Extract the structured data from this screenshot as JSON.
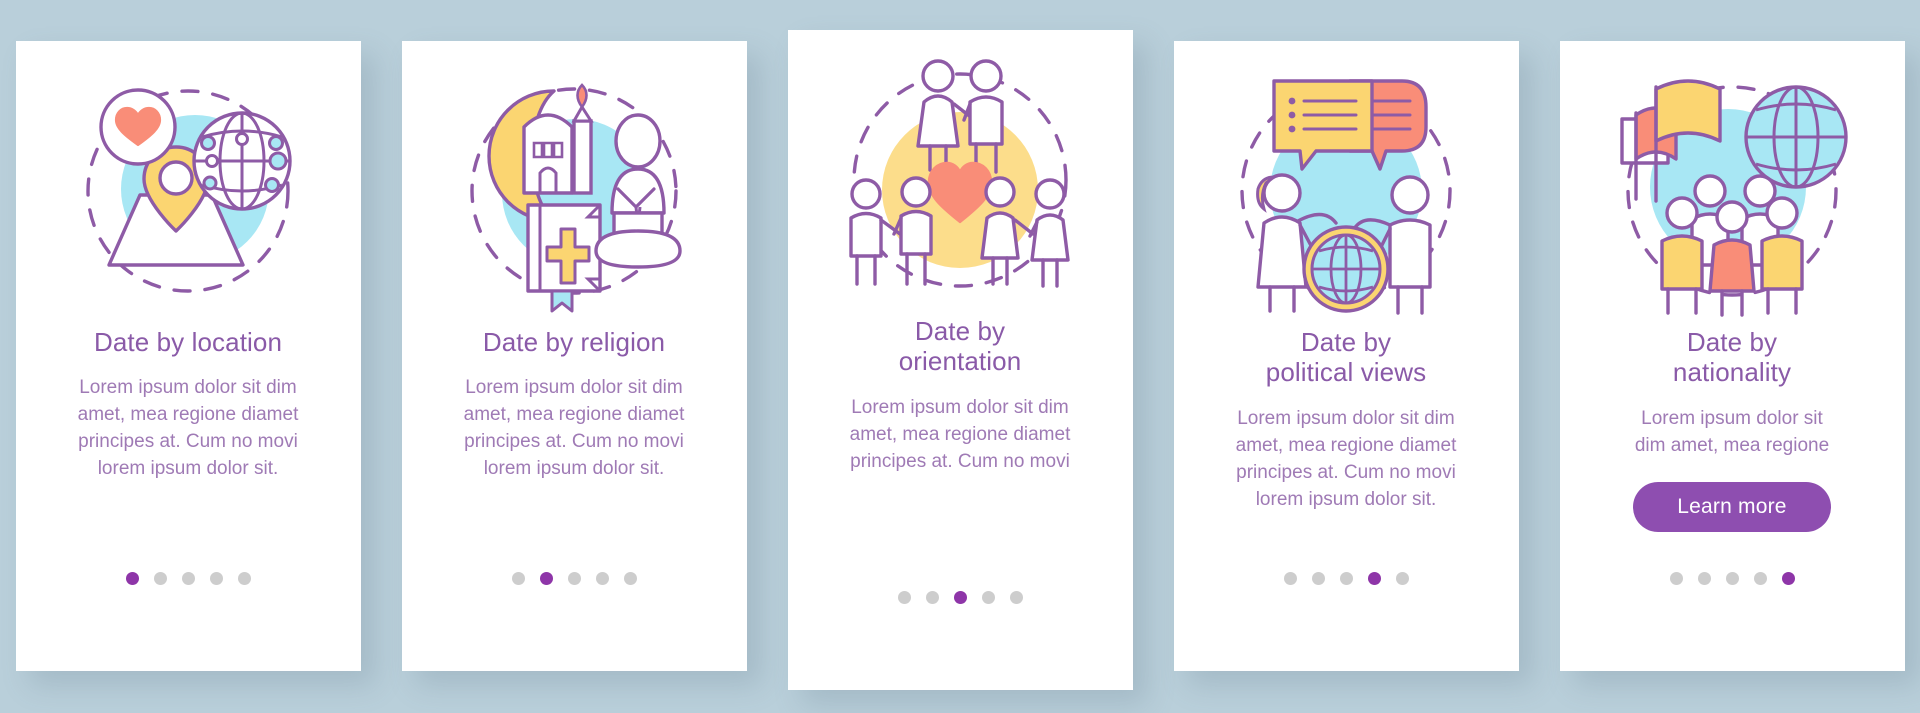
{
  "theme": {
    "background": "#b9cfda",
    "card_background": "#ffffff",
    "title_color": "#8a5aa8",
    "body_color": "#9f7ab5",
    "accent_purple": "#8e4eb0",
    "dot_active": "#8e35a8",
    "dot_inactive": "#cdcdcd",
    "illo_stroke": "#8e5ba6",
    "illo_blue": "#a8e7f4",
    "illo_yellow": "#fbd571",
    "illo_coral": "#f98d78"
  },
  "screens": [
    {
      "id": "date-by-location",
      "icon": "location-heart-globe-icon",
      "title_lines": [
        "Date by location"
      ],
      "body_lines": [
        "Lorem ipsum dolor sit dim",
        "amet, mea regione diamet",
        "principes at. Cum no movi",
        "lorem ipsum dolor sit."
      ],
      "dots": {
        "count": 5,
        "active_index": 0
      },
      "button": null
    },
    {
      "id": "date-by-religion",
      "icon": "religion-symbols-icon",
      "title_lines": [
        "Date by religion"
      ],
      "body_lines": [
        "Lorem ipsum dolor sit dim",
        "amet, mea regione diamet",
        "principes at. Cum no movi",
        "lorem ipsum dolor sit."
      ],
      "dots": {
        "count": 5,
        "active_index": 1
      },
      "button": null
    },
    {
      "id": "date-by-orientation",
      "icon": "couples-heart-icon",
      "title_lines": [
        "Date by",
        "orientation"
      ],
      "body_lines": [
        "Lorem ipsum dolor sit dim",
        "amet, mea regione diamet",
        "principes at. Cum no movi"
      ],
      "dots": {
        "count": 5,
        "active_index": 2
      },
      "button": null
    },
    {
      "id": "date-by-political-views",
      "icon": "debate-speech-globe-icon",
      "title_lines": [
        "Date by",
        "political views"
      ],
      "body_lines": [
        "Lorem ipsum dolor sit dim",
        "amet, mea regione diamet",
        "principes at. Cum no movi",
        "lorem ipsum dolor sit."
      ],
      "dots": {
        "count": 5,
        "active_index": 3
      },
      "button": null
    },
    {
      "id": "date-by-nationality",
      "icon": "flags-globe-people-icon",
      "title_lines": [
        "Date by",
        "nationality"
      ],
      "body_lines": [
        "Lorem ipsum dolor sit",
        "dim amet, mea regione"
      ],
      "dots": {
        "count": 5,
        "active_index": 4
      },
      "button": {
        "label": "Learn more"
      }
    }
  ]
}
